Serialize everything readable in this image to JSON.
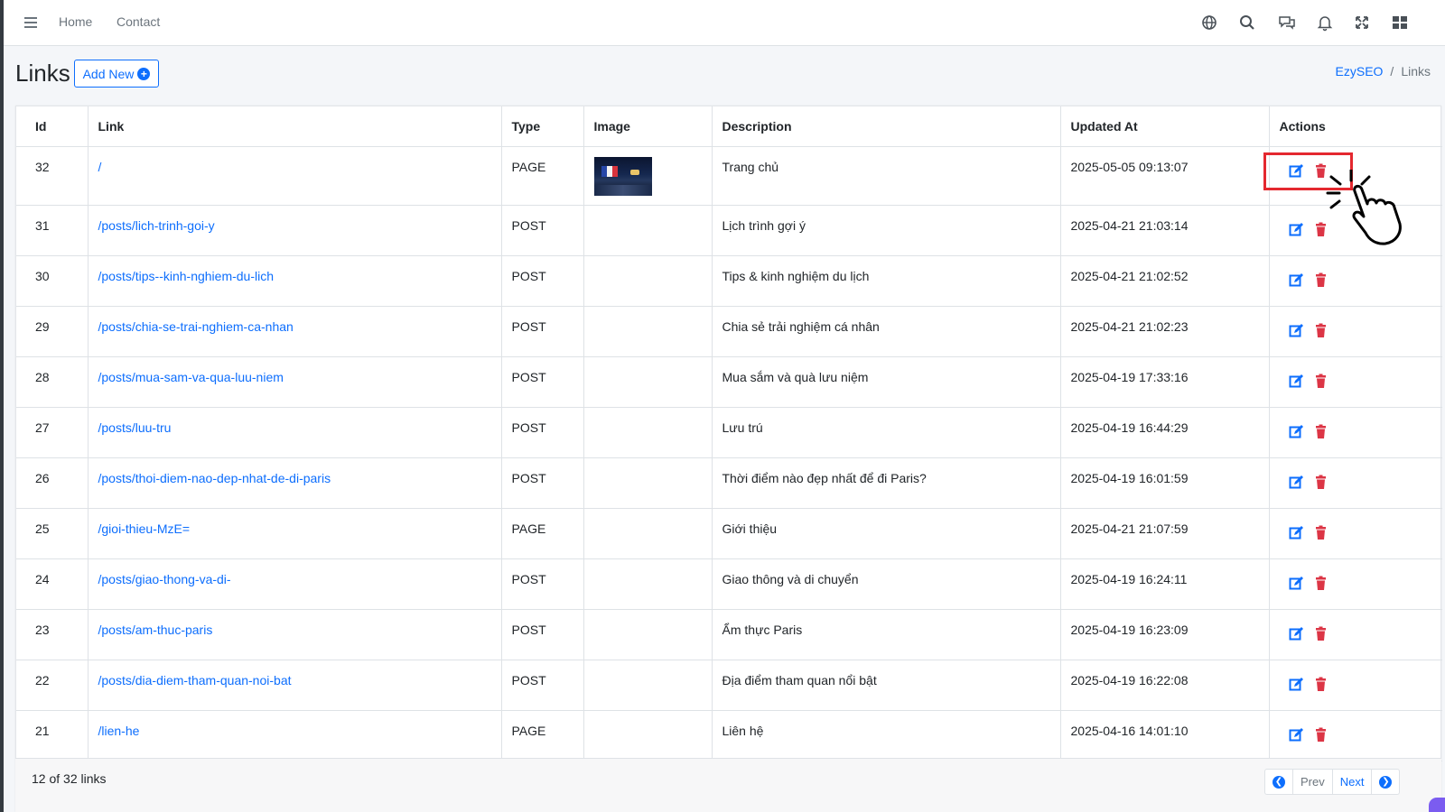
{
  "navbar": {
    "links": [
      {
        "label": "Home"
      },
      {
        "label": "Contact"
      }
    ],
    "icons": [
      "menu-icon",
      "globe-icon",
      "search-icon",
      "chat-icon",
      "bell-icon",
      "fullscreen-icon",
      "grid-icon"
    ]
  },
  "header": {
    "title": "Links",
    "add_label": "Add New",
    "breadcrumb": {
      "home": "EzySEO",
      "separator": "/",
      "current": "Links"
    }
  },
  "table": {
    "columns": [
      "Id",
      "Link",
      "Type",
      "Image",
      "Description",
      "Updated At",
      "Actions"
    ],
    "rows": [
      {
        "id": "32",
        "link": "/",
        "type": "PAGE",
        "has_image": true,
        "description": "Trang chủ",
        "updated": "2025-05-05 09:13:07"
      },
      {
        "id": "31",
        "link": "/posts/lich-trinh-goi-y",
        "type": "POST",
        "has_image": false,
        "description": "Lịch trình gợi ý",
        "updated": "2025-04-21 21:03:14"
      },
      {
        "id": "30",
        "link": "/posts/tips--kinh-nghiem-du-lich",
        "type": "POST",
        "has_image": false,
        "description": "Tips & kinh nghiệm du lịch",
        "updated": "2025-04-21 21:02:52"
      },
      {
        "id": "29",
        "link": "/posts/chia-se-trai-nghiem-ca-nhan",
        "type": "POST",
        "has_image": false,
        "description": "Chia sẻ trải nghiệm cá nhân",
        "updated": "2025-04-21 21:02:23"
      },
      {
        "id": "28",
        "link": "/posts/mua-sam-va-qua-luu-niem",
        "type": "POST",
        "has_image": false,
        "description": "Mua sắm và quà lưu niệm",
        "updated": "2025-04-19 17:33:16"
      },
      {
        "id": "27",
        "link": "/posts/luu-tru",
        "type": "POST",
        "has_image": false,
        "description": "Lưu trú",
        "updated": "2025-04-19 16:44:29"
      },
      {
        "id": "26",
        "link": "/posts/thoi-diem-nao-dep-nhat-de-di-paris",
        "type": "POST",
        "has_image": false,
        "description": "Thời điểm nào đẹp nhất để đi Paris?",
        "updated": "2025-04-19 16:01:59"
      },
      {
        "id": "25",
        "link": "/gioi-thieu-MzE=",
        "type": "PAGE",
        "has_image": false,
        "description": "Giới thiệu",
        "updated": "2025-04-21 21:07:59"
      },
      {
        "id": "24",
        "link": "/posts/giao-thong-va-di-",
        "type": "POST",
        "has_image": false,
        "description": "Giao thông và di chuyển",
        "updated": "2025-04-19 16:24:11"
      },
      {
        "id": "23",
        "link": "/posts/am-thuc-paris",
        "type": "POST",
        "has_image": false,
        "description": "Ẩm thực Paris",
        "updated": "2025-04-19 16:23:09"
      },
      {
        "id": "22",
        "link": "/posts/dia-diem-tham-quan-noi-bat",
        "type": "POST",
        "has_image": false,
        "description": "Địa điểm tham quan nổi bật",
        "updated": "2025-04-19 16:22:08"
      },
      {
        "id": "21",
        "link": "/lien-he",
        "type": "PAGE",
        "has_image": false,
        "description": "Liên hệ",
        "updated": "2025-04-16 14:01:10"
      }
    ]
  },
  "footer": {
    "summary": "12 of 32 links",
    "prev_label": "Prev",
    "next_label": "Next"
  },
  "colors": {
    "primary": "#0d6efd",
    "danger": "#dc3545",
    "highlight": "#e4282f"
  }
}
